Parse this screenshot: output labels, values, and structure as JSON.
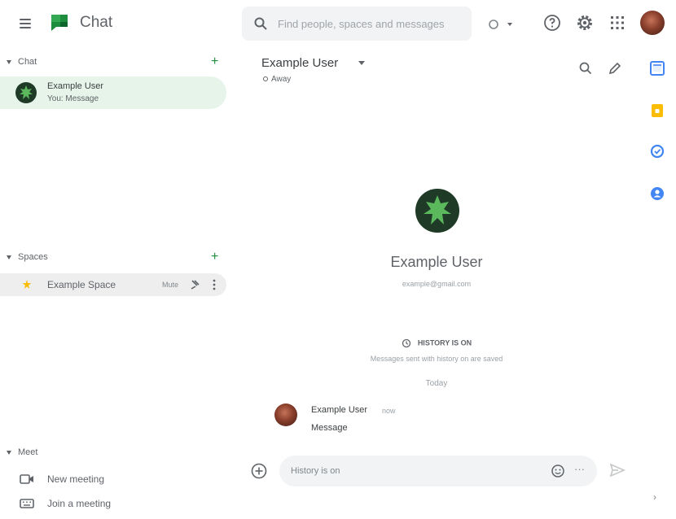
{
  "header": {
    "app_title": "Chat",
    "search_placeholder": "Find people, spaces and messages",
    "icons": [
      "menu-icon",
      "chat-logo-icon",
      "search-icon",
      "status-icon",
      "help-icon",
      "settings-icon",
      "apps-grid-icon",
      "account-avatar"
    ]
  },
  "sidebar": {
    "chat_section": {
      "label": "Chat",
      "items": [
        {
          "name": "Example User",
          "preview": "You: Message"
        }
      ]
    },
    "spaces_section": {
      "label": "Spaces",
      "items": [
        {
          "name": "Example Space",
          "badge": "Mute"
        }
      ]
    },
    "meet_section": {
      "label": "Meet",
      "items": [
        {
          "label": "New meeting",
          "icon": "video-camera-icon"
        },
        {
          "label": "Join a meeting",
          "icon": "keyboard-icon"
        }
      ]
    }
  },
  "conversation": {
    "title": "Example User",
    "status": "Away",
    "profile_name": "Example User",
    "profile_email": "example@gmail.com",
    "history_label": "HISTORY IS ON",
    "history_sub": "Messages sent with history on are saved",
    "date_separator": "Today",
    "messages": [
      {
        "author": "Example User",
        "time": "now",
        "text": "Message"
      }
    ],
    "composer_placeholder": "History is on"
  },
  "right_rail": {
    "icons": [
      "calendar-icon",
      "keep-icon",
      "tasks-icon",
      "contacts-icon",
      "expand-icon"
    ]
  },
  "colors": {
    "accent_green": "#1e8e3e",
    "selected_bg": "#e6f4ea",
    "search_bg": "#f1f3f4"
  }
}
